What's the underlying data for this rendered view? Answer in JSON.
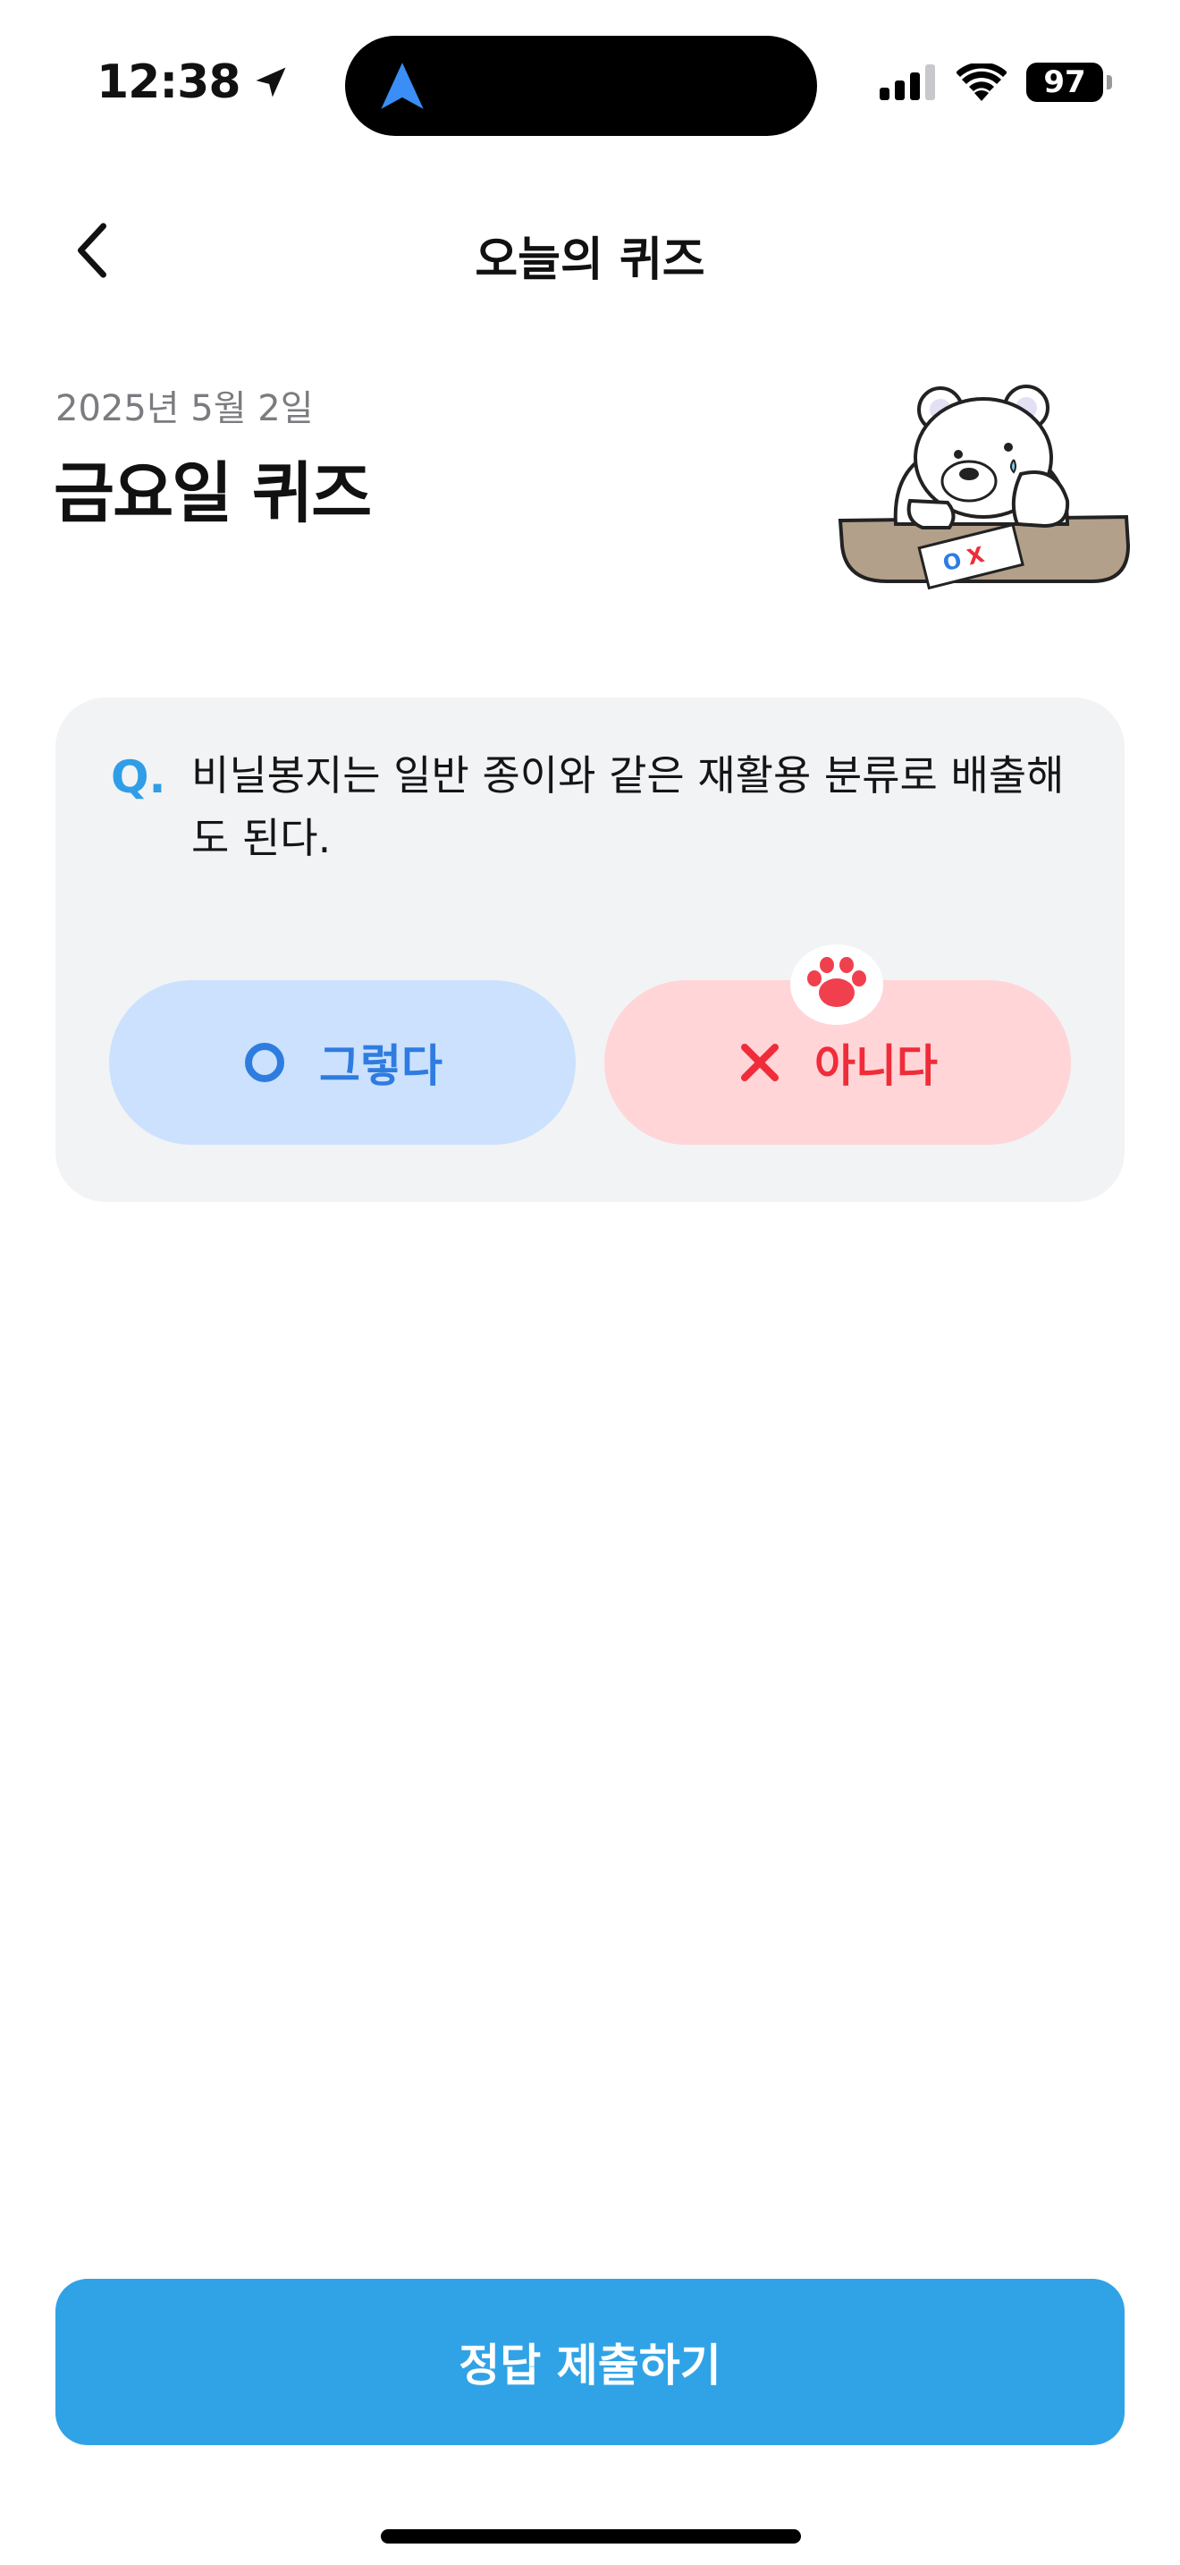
{
  "status_bar": {
    "time": "12:38",
    "battery": "97",
    "icons": [
      "location-arrow-icon",
      "navigation-icon",
      "cellular-signal-icon",
      "wifi-icon",
      "battery-icon"
    ]
  },
  "header": {
    "title": "오늘의 퀴즈",
    "back_icon": "chevron-left-icon"
  },
  "intro": {
    "date": "2025년 5월 2일",
    "day_title": "금요일 퀴즈"
  },
  "question": {
    "prefix": "Q.",
    "text": "비닐봉지는 일반 종이와 같은 재활용 분류로 배출해도 된다."
  },
  "answers": [
    {
      "label": "그렇다",
      "icon": "circle-o-icon",
      "color": "#2f7ce0",
      "background": "#cbe1fd"
    },
    {
      "label": "아니다",
      "icon": "cross-x-icon",
      "color": "#f02c3a",
      "background": "#ffd5d8",
      "selected": true
    }
  ],
  "mascot_paper": {
    "o": "O",
    "x": "X"
  },
  "submit": {
    "label": "정답 제출하기",
    "color": "#30a3e6"
  }
}
